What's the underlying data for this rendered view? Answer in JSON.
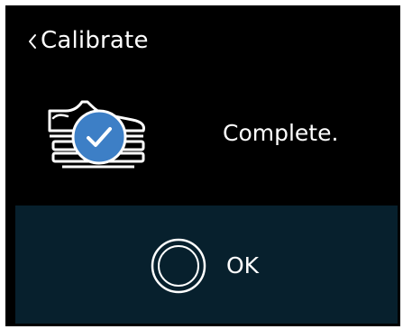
{
  "header": {
    "back_icon": "chevron-left-icon",
    "title": "Calibrate"
  },
  "status": {
    "illustration_icon": "shoe-on-scale-check-icon",
    "message": "Complete."
  },
  "footer": {
    "ok_icon": "ring-button-icon",
    "ok_label": "OK"
  },
  "colors": {
    "background": "#000000",
    "footer_panel": "#07202d",
    "check_badge": "#3d7fc6",
    "text": "#ffffff"
  }
}
